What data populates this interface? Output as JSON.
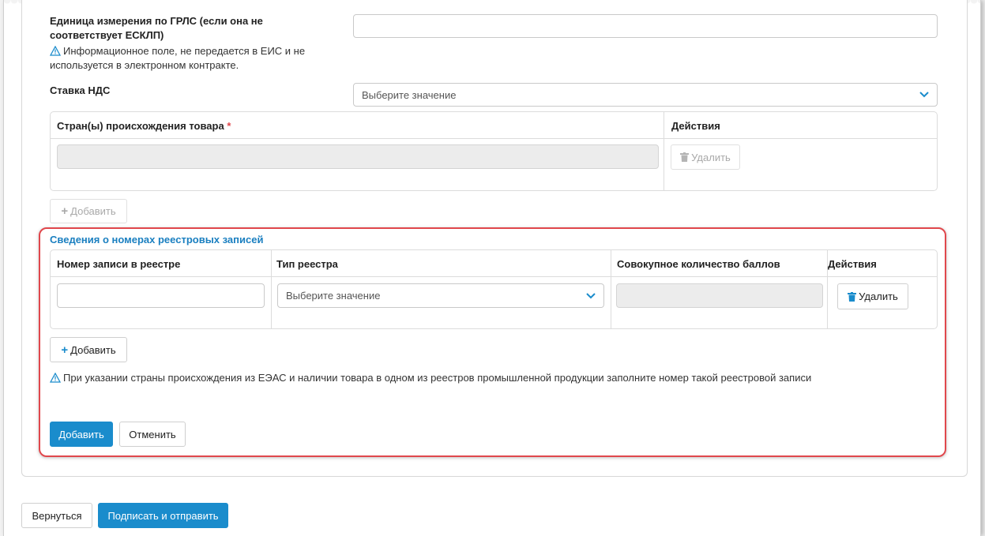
{
  "grls_unit": {
    "label_line1": "Единица измерения по ГРЛС (если она не",
    "label_line2": "соответствует ЕСКЛП)",
    "note_line1": "Информационное поле, не передается в ЕИС и не",
    "note_line2": "используется в электронном контракте.",
    "value": ""
  },
  "vat": {
    "label": "Ставка НДС",
    "placeholder": "Выберите значение"
  },
  "origin_table": {
    "header_country": "Стран(ы) происхождения товара",
    "required_mark": "*",
    "header_actions": "Действия",
    "delete_label": "Удалить",
    "add_label": "Добавить"
  },
  "registry": {
    "title": "Сведения о номерах реестровых записей",
    "columns": [
      "Номер записи в реестре",
      "Тип реестра",
      "Совокупное количество баллов",
      "Действия"
    ],
    "row": {
      "record_number": "",
      "registry_type_placeholder": "Выберите значение",
      "total_points": "",
      "delete_label": "Удалить"
    },
    "add_label": "Добавить",
    "warning": "При указании страны происхождения из ЕЭАС и наличии товара в одном из реестров промышленной продукции заполните номер такой реестровой записи",
    "submit_label": "Добавить",
    "cancel_label": "Отменить"
  },
  "footer": {
    "back_label": "Вернуться",
    "sign_label": "Подписать и отправить"
  },
  "colors": {
    "accent": "#1a8ccc",
    "highlight": "#e0474c",
    "link": "#1a7fc0"
  }
}
